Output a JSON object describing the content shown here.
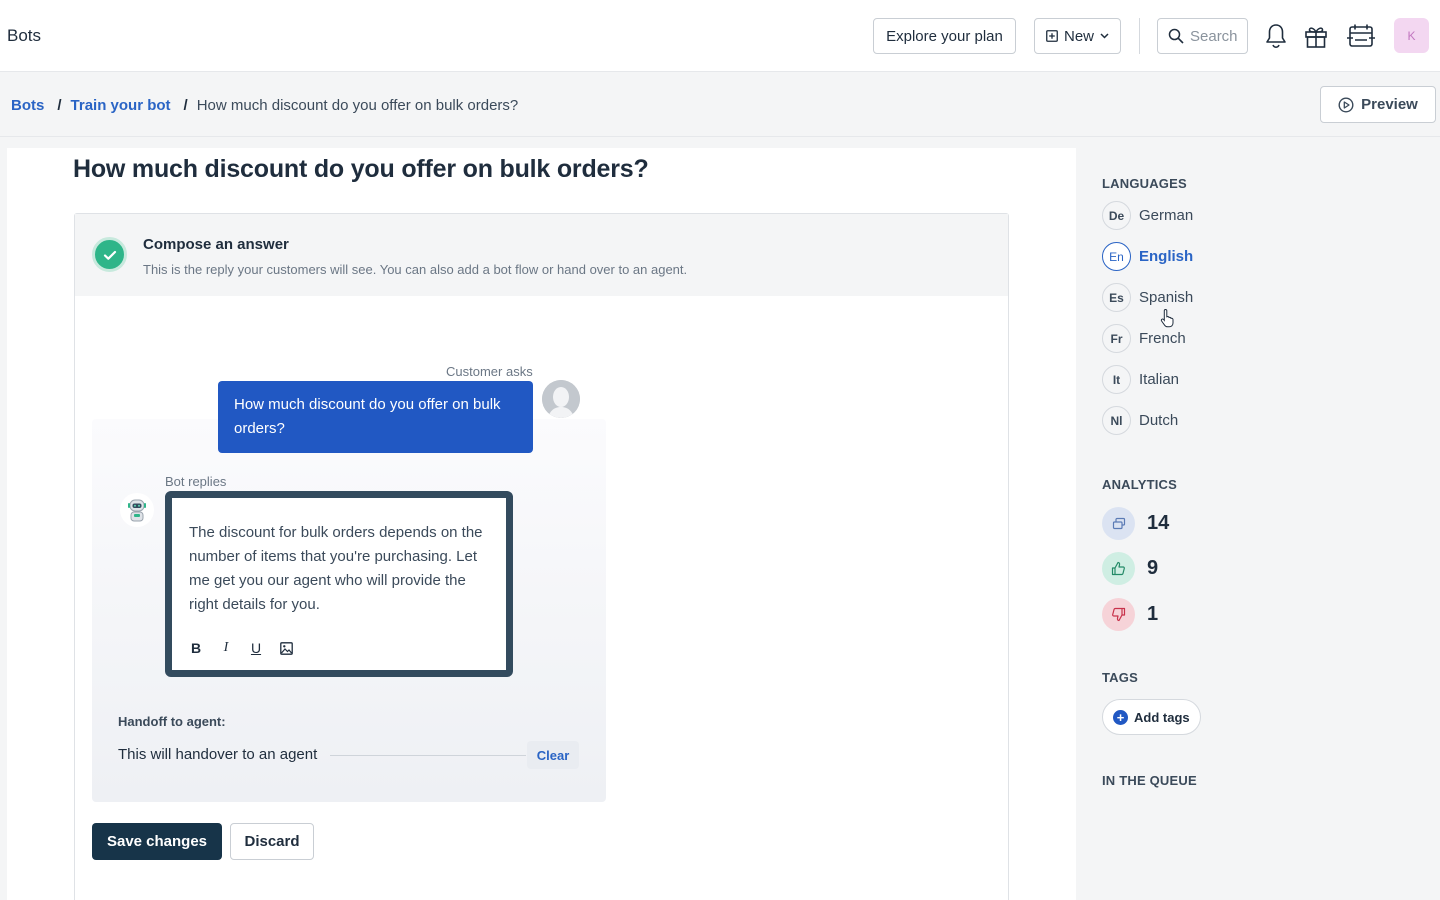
{
  "header": {
    "title": "Bots",
    "explore_label": "Explore your plan",
    "new_label": "New",
    "search_placeholder": "Search",
    "avatar_initial": "K"
  },
  "breadcrumb": {
    "items": [
      "Bots",
      "Train your bot"
    ],
    "separator": "/",
    "current": "How much discount do you offer on bulk orders?",
    "preview_label": "Preview"
  },
  "main": {
    "title": "How much discount do you offer on bulk orders?",
    "card": {
      "title": "Compose an answer",
      "subtitle": "This is the reply your customers will see. You can also add a bot flow or hand over to an agent."
    },
    "chat": {
      "customer_label": "Customer asks",
      "customer_message": "How much discount do you offer on bulk orders?",
      "bot_label": "Bot replies",
      "bot_message": "The discount for bulk orders depends on the number of items that you're purchasing. Let me get you our agent who will provide the right details for you.",
      "toolbar": {
        "bold": "B",
        "italic": "I",
        "underline": "U"
      }
    },
    "handoff": {
      "label": "Handoff to agent:",
      "text": "This will handover to an agent",
      "clear_label": "Clear"
    },
    "save_label": "Save changes",
    "discard_label": "Discard"
  },
  "sidebar": {
    "languages_title": "LANGUAGES",
    "languages": [
      {
        "code": "De",
        "name": "German",
        "active": false
      },
      {
        "code": "En",
        "name": "English",
        "active": true
      },
      {
        "code": "Es",
        "name": "Spanish",
        "active": false
      },
      {
        "code": "Fr",
        "name": "French",
        "active": false
      },
      {
        "code": "It",
        "name": "Italian",
        "active": false
      },
      {
        "code": "Nl",
        "name": "Dutch",
        "active": false
      }
    ],
    "analytics_title": "ANALYTICS",
    "analytics": [
      {
        "icon": "conversations-icon",
        "value": "14",
        "color": "#dbe3f2"
      },
      {
        "icon": "thumbs-up-icon",
        "value": "9",
        "color": "#cfeee3"
      },
      {
        "icon": "thumbs-down-icon",
        "value": "1",
        "color": "#f6d3d8"
      }
    ],
    "tags_title": "TAGS",
    "add_tags_label": "Add tags",
    "queue_title": "IN THE QUEUE"
  },
  "colors": {
    "accent": "#2a64c5",
    "bubble": "#2158c3",
    "save_button": "#173449",
    "success": "#2eb589"
  }
}
